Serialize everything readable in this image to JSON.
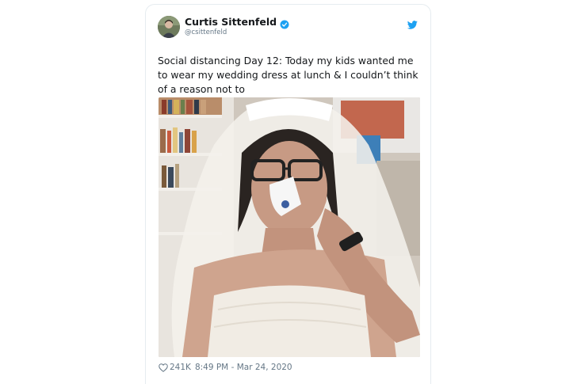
{
  "tweet": {
    "display_name": "Curtis Sittenfeld",
    "handle": "@csittenfeld",
    "text": "Social distancing Day 12: Today my kids wanted me to wear my wedding dress at lunch & I couldn’t think of a reason not to",
    "likes": "241K",
    "timestamp": "8:49 PM - Mar 24, 2020",
    "verified": true
  },
  "icons": {
    "verified": "verified-badge-icon",
    "brand": "bird-icon",
    "like": "heart-icon"
  },
  "colors": {
    "brand_blue": "#1da1f2",
    "text_primary": "#14171a",
    "text_secondary": "#657786",
    "border": "#e6ecf0"
  }
}
